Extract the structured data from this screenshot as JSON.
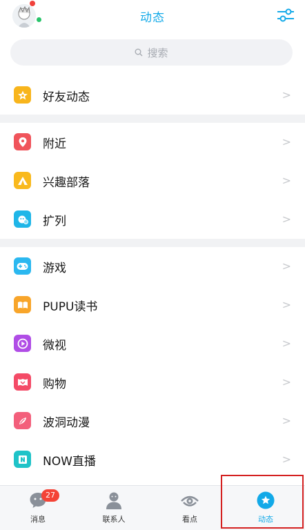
{
  "header": {
    "title": "动态"
  },
  "search": {
    "placeholder": "搜索"
  },
  "sections": [
    [
      {
        "label": "好友动态",
        "icon": "star-icon",
        "color": "#f8b51c"
      }
    ],
    [
      {
        "label": "附近",
        "icon": "location-pin-icon",
        "color": "#f0545b"
      },
      {
        "label": "兴趣部落",
        "icon": "tent-icon",
        "color": "#f9b91d"
      },
      {
        "label": "扩列",
        "icon": "expand-friends-icon",
        "color": "#1fb6e8"
      }
    ],
    [
      {
        "label": "游戏",
        "icon": "gamepad-icon",
        "color": "#2bb8f0"
      },
      {
        "label": "PUPU读书",
        "icon": "book-icon",
        "color": "#f8a52a"
      },
      {
        "label": "微视",
        "icon": "play-icon",
        "color": "#b04de6"
      },
      {
        "label": "购物",
        "icon": "shopping-bag-icon",
        "color": "#f44b67"
      },
      {
        "label": "波洞动漫",
        "icon": "anime-icon",
        "color": "#f35f7b"
      },
      {
        "label": "NOW直播",
        "icon": "live-icon",
        "color": "#1fc3c8"
      }
    ]
  ],
  "tabbar": {
    "tabs": [
      {
        "label": "消息",
        "badge": "27"
      },
      {
        "label": "联系人"
      },
      {
        "label": "看点"
      },
      {
        "label": "动态"
      }
    ],
    "active_color": "#12a9e8"
  }
}
